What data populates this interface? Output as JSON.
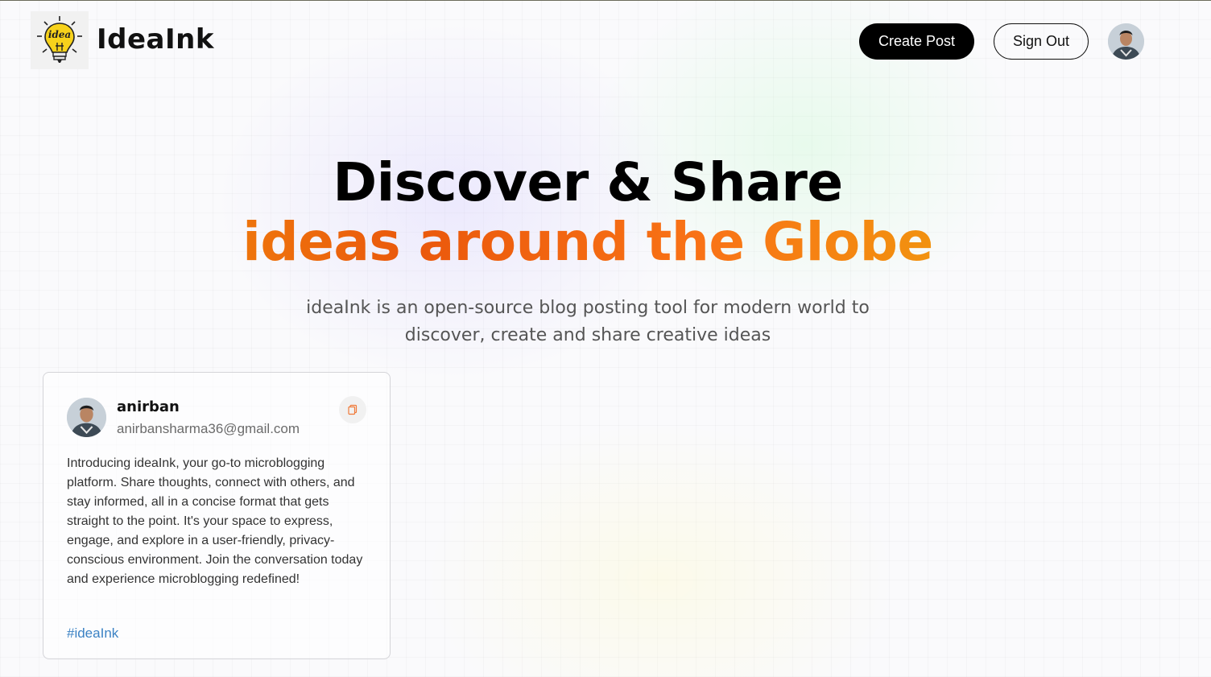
{
  "header": {
    "brand": "IdeaInk",
    "logo_text": "idea",
    "logo_icon": "lightbulb-icon",
    "create_label": "Create Post",
    "signout_label": "Sign Out",
    "avatar_icon": "user-avatar"
  },
  "hero": {
    "line1": "Discover & Share",
    "line2": "ideas around the Globe",
    "description": "ideaInk is an open-source blog posting tool for modern world to discover, create and share creative ideas"
  },
  "post": {
    "username": "anirban",
    "email": "anirbansharma36@gmail.com",
    "copy_icon": "copy-icon",
    "body": "Introducing ideaInk, your go-to microblogging platform. Share thoughts, connect with others, and stay informed, all in a concise format that gets straight to the point. It's your space to express, engage, and explore in a user-friendly, privacy-conscious environment. Join the conversation today and experience microblogging redefined!",
    "tag": "#ideaInk"
  },
  "colors": {
    "accent_gradient": [
      "#f59e0b",
      "#ea580c",
      "#eab308"
    ],
    "tag_color": "#3b82c4"
  }
}
